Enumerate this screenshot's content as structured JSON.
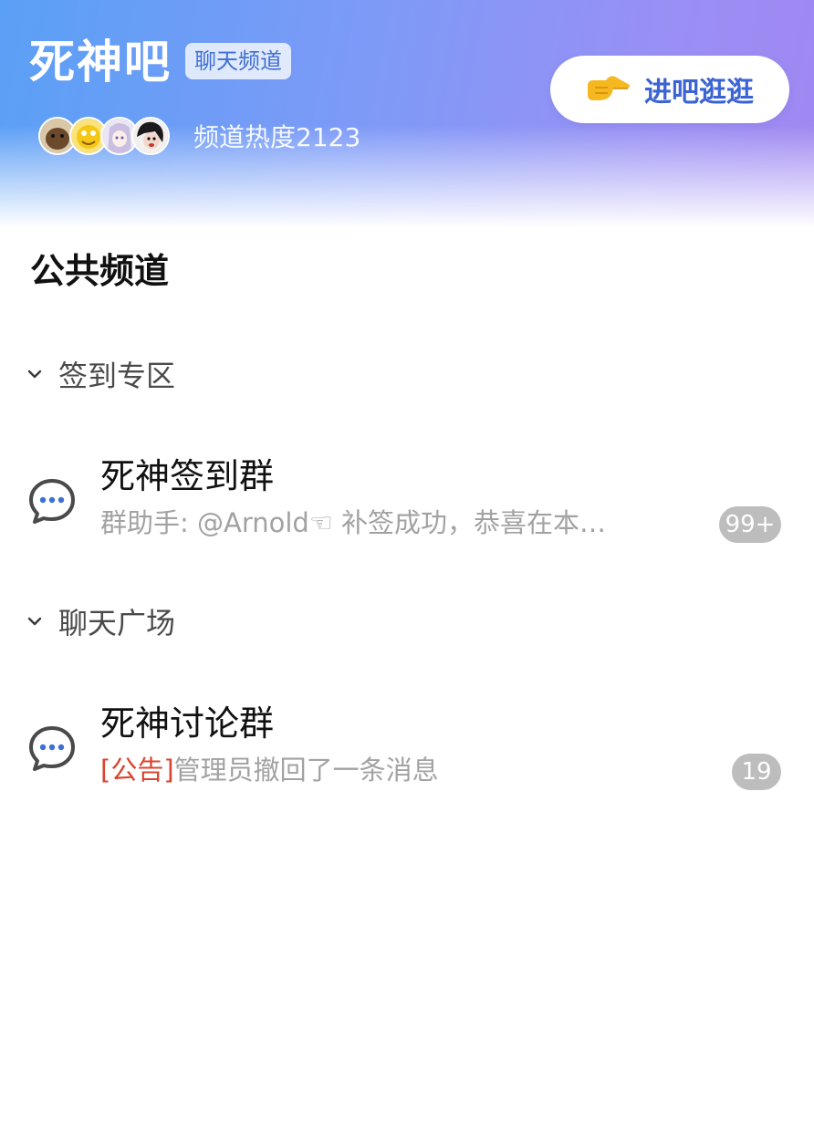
{
  "header": {
    "title": "死神吧",
    "tag": "聊天频道",
    "heat": "频道热度2123",
    "enter_button": "进吧逛逛",
    "enter_icon": "pointing-hand-icon",
    "gradient": [
      "#5aa0f6",
      "#a087f1"
    ]
  },
  "section_title": "公共频道",
  "groups": [
    {
      "label": "签到专区",
      "channels": [
        {
          "name": "死神签到群",
          "preview_tag": "",
          "preview": "群助手: @Arnold☜ 补签成功，恭喜在本…",
          "badge": "99+"
        }
      ]
    },
    {
      "label": "聊天广场",
      "channels": [
        {
          "name": "死神讨论群",
          "preview_tag": "[公告]",
          "preview": "管理员撤回了一条消息",
          "badge": "19"
        }
      ]
    }
  ],
  "colors": {
    "accent": "#3b63d4",
    "announcement": "#d9442f",
    "badge": "#bdbdbd",
    "chat_icon_dots": "#3e6fd3"
  }
}
